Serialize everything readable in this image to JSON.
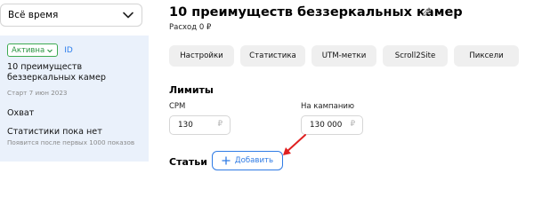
{
  "sidebar": {
    "period": "Всё время",
    "campaign": {
      "status": "Активна",
      "id_label": "ID",
      "title": "10 преимуществ беззеркальных камер",
      "start": "Старт 7 июн 2023",
      "reach": "Охват",
      "stats": "Статистики пока нет",
      "stats_hint": "Появится после первых 1000 показов"
    }
  },
  "main": {
    "title": "10 преимуществ беззеркальных камер",
    "spend": "Расход 0 ₽",
    "tabs": [
      "Настройки",
      "Статистика",
      "UTM-метки",
      "Scroll2Site",
      "Пиксели"
    ],
    "limits": {
      "heading": "Лимиты",
      "cpm_label": "CPM",
      "cpm_value": "130",
      "campaign_label": "На кампанию",
      "campaign_value": "130 000",
      "currency": "₽"
    },
    "articles": {
      "heading": "Статьи",
      "add_label": "Добавить"
    }
  },
  "colors": {
    "accent": "#2f7be5",
    "active_green": "#2b9440",
    "card_bg": "#eaf1fb",
    "arrow_red": "#e02020"
  },
  "icons": [
    "chevron-down-icon",
    "pencil-icon",
    "plus-icon",
    "arrow-annotation"
  ]
}
